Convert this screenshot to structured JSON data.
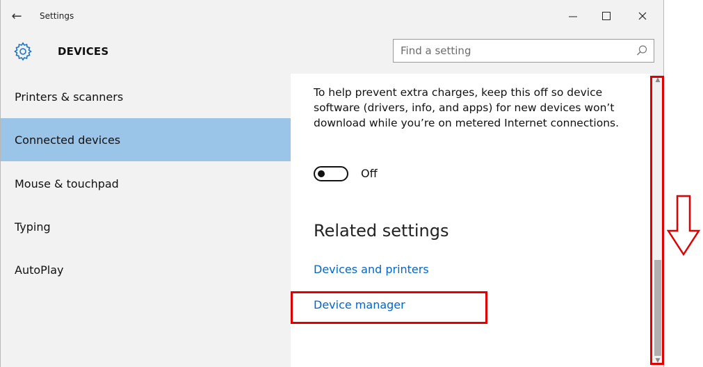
{
  "window": {
    "title": "Settings",
    "section_title": "DEVICES"
  },
  "search": {
    "placeholder": "Find a setting",
    "value": ""
  },
  "sidebar": {
    "items": [
      {
        "label": "Printers & scanners",
        "selected": false
      },
      {
        "label": "Connected devices",
        "selected": true
      },
      {
        "label": "Mouse & touchpad",
        "selected": false
      },
      {
        "label": "Typing",
        "selected": false
      },
      {
        "label": "AutoPlay",
        "selected": false
      }
    ]
  },
  "content": {
    "description": "To help prevent extra charges, keep this off so device software (drivers, info, and apps) for new devices won’t download while you’re on metered Internet connections.",
    "toggle": {
      "state": "off",
      "label": "Off"
    },
    "related_title": "Related settings",
    "links": [
      {
        "label": "Devices and printers"
      },
      {
        "label": "Device manager"
      }
    ]
  },
  "icons": {
    "back": "back-arrow-icon",
    "minimize": "minimize-icon",
    "maximize": "maximize-icon",
    "close": "close-icon",
    "section": "gear-icon",
    "search": "search-icon"
  },
  "colors": {
    "selected_nav": "#9ac4e8",
    "link": "#0066cc",
    "annotation": "#e00000"
  }
}
